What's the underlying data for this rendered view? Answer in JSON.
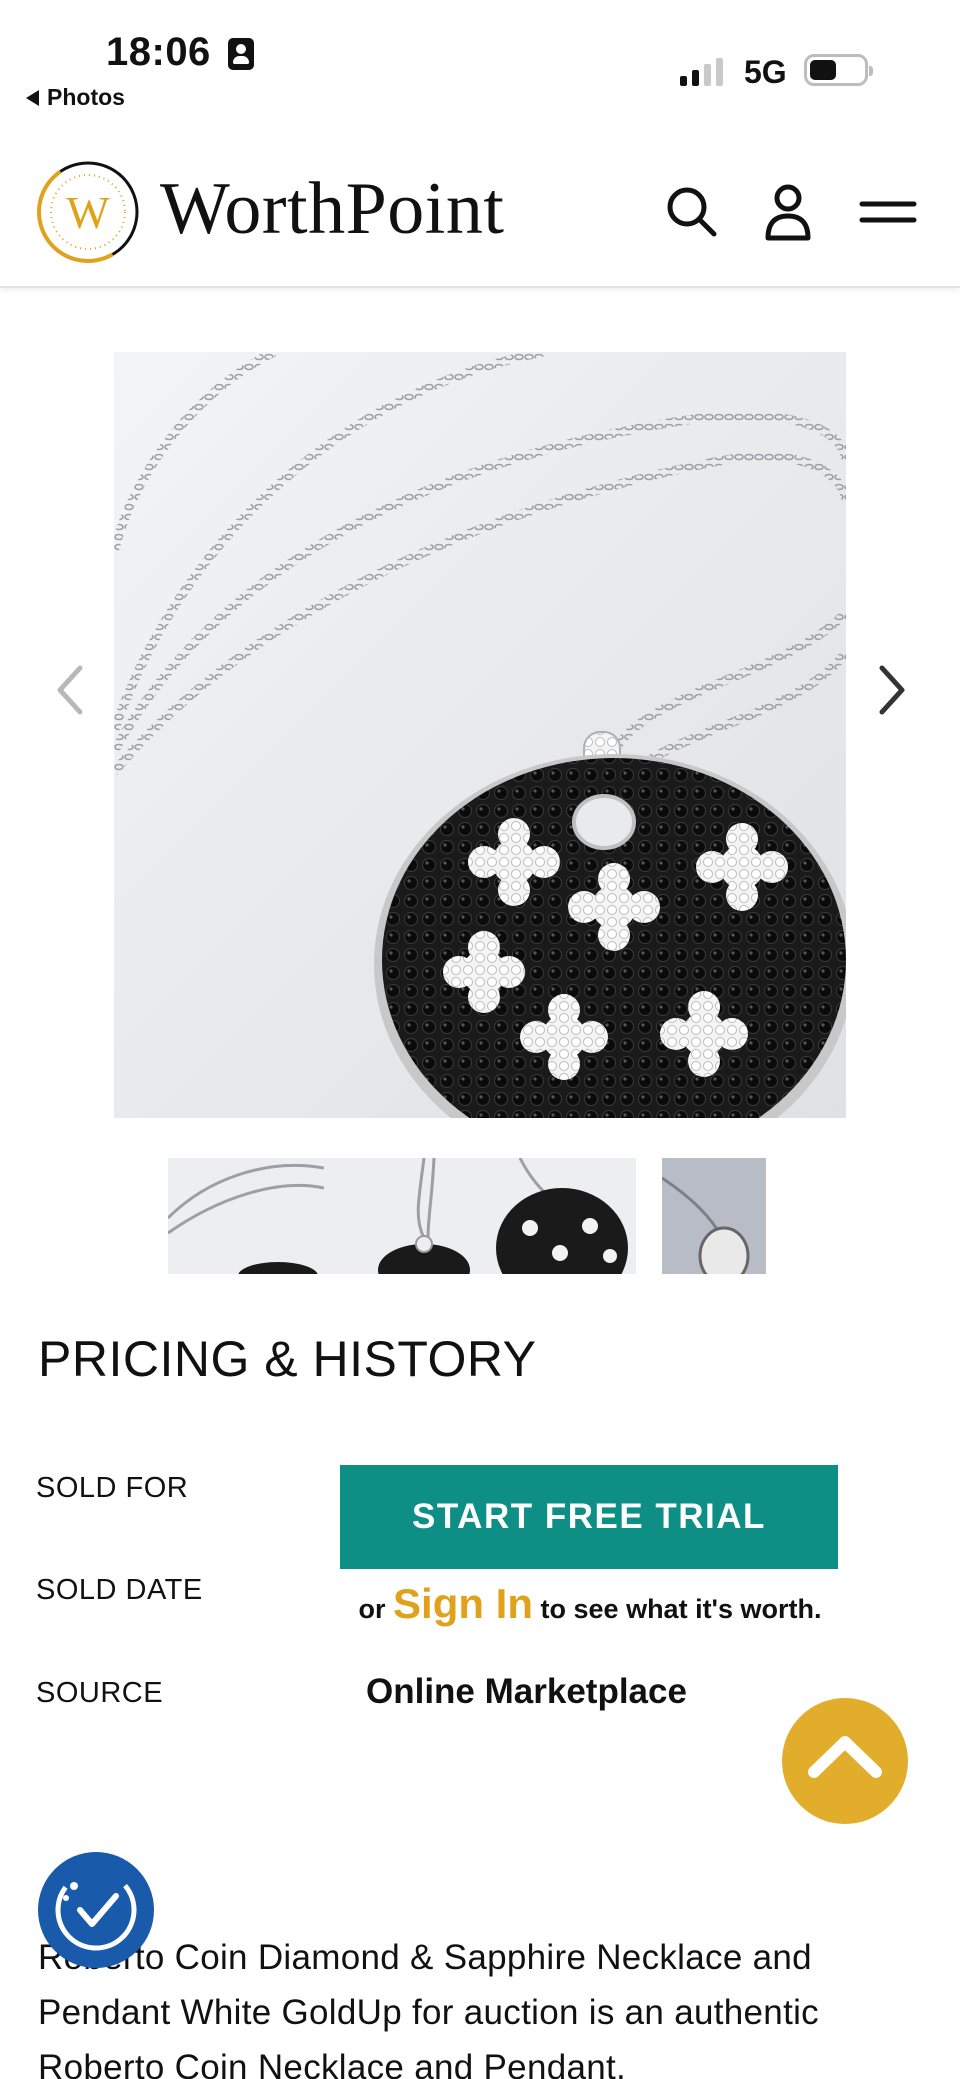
{
  "status_bar": {
    "time": "18:06",
    "back_label": "Photos",
    "network": "5G",
    "signal_icon": "cellular-signal-icon",
    "battery_icon": "battery-icon"
  },
  "header": {
    "logo_letter": "W",
    "brand_name": "WorthPoint",
    "search_icon": "search-icon",
    "account_icon": "user-account-icon",
    "menu_icon": "hamburger-menu-icon"
  },
  "gallery": {
    "prev_icon": "chevron-left-icon",
    "next_icon": "chevron-right-icon",
    "thumbnail_count": 4
  },
  "pricing": {
    "title": "PRICING & HISTORY",
    "sold_for_label": "SOLD FOR",
    "sold_date_label": "SOLD DATE",
    "source_label": "SOURCE",
    "trial_button": "START FREE TRIAL",
    "signin_prefix": "or",
    "signin_link": "Sign In",
    "signin_suffix": "to see what it's worth.",
    "source_value": "Online Marketplace"
  },
  "floating": {
    "scroll_top_icon": "chevron-up-icon",
    "accessibility_icon": "accessibility-check-icon"
  },
  "description": {
    "text": "Roberto Coin Diamond & Sapphire Necklace and Pendant White GoldUp for auction is an authentic Roberto Coin Necklace and Pendant."
  },
  "colors": {
    "accent_teal": "#0e8f86",
    "accent_gold": "#e0a11b",
    "accessibility_blue": "#1a5aaa"
  }
}
